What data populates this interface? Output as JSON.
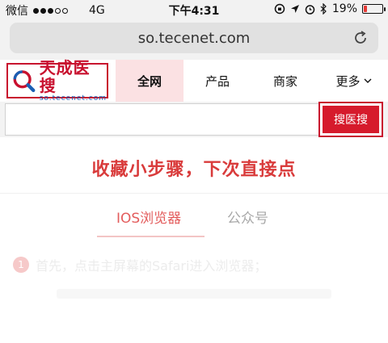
{
  "status_bar": {
    "carrier": "微信",
    "network": "4G",
    "time": "下午4:31",
    "battery": "19%",
    "battery_level": 0.19
  },
  "browser": {
    "url": "so.tecenet.com"
  },
  "site": {
    "logo_name": "天成医搜",
    "logo_domain": "so.tecenet.com",
    "nav": [
      {
        "label": "全网"
      },
      {
        "label": "产品"
      },
      {
        "label": "商家"
      },
      {
        "label": "更多"
      }
    ]
  },
  "search": {
    "value": "",
    "button_label": "搜医搜"
  },
  "guide": {
    "headline": "收藏小步骤，下次直接点",
    "tabs": [
      {
        "label": "IOS浏览器"
      },
      {
        "label": "公众号"
      }
    ],
    "step_number": "1",
    "step_text": "首先，点击主屏幕的Safari进入浏览器；"
  },
  "colors": {
    "brand": "#c8102e",
    "accent": "#d93b3b"
  }
}
